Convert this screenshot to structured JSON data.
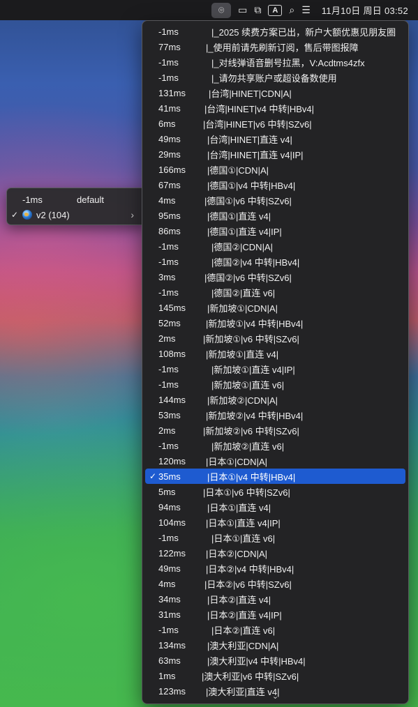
{
  "menubar": {
    "icons": [
      {
        "name": "proxy-app-icon",
        "glyph": "⌾",
        "active": true
      },
      {
        "name": "camera-icon",
        "glyph": "▭",
        "active": false
      },
      {
        "name": "screen-mirroring-icon",
        "glyph": "⧉",
        "active": false
      },
      {
        "name": "input-method-icon",
        "glyph": "A",
        "active": false
      },
      {
        "name": "spotlight-search-icon",
        "glyph": "⌕",
        "active": false
      },
      {
        "name": "control-center-icon",
        "glyph": "☰",
        "active": false
      }
    ],
    "clock": "11月10日 周日 03:52"
  },
  "profile_menu": {
    "latency": "-1ms",
    "group_name": "default",
    "selected_check": "✓",
    "subscription": "v2 (104)",
    "chevron": "›"
  },
  "server_menu": {
    "selected_check": "✓",
    "scroll_indicator": "⌄",
    "items": [
      {
        "latency": "-1ms",
        "name": "|_2025 续费方案已出，新户大额优惠见朋友圈",
        "indent": 76
      },
      {
        "latency": "77ms",
        "name": "|_使用前请先刷新订阅，售后带图报障",
        "indent": 68
      },
      {
        "latency": "-1ms",
        "name": "|_对线弹语音删号拉黑，V:Acdtms4zfx",
        "indent": 76
      },
      {
        "latency": "-1ms",
        "name": "|_请勿共享账户或超设备数使用",
        "indent": 76
      },
      {
        "latency": "131ms",
        "name": "|台湾|HINET|CDN|A|",
        "indent": 72
      },
      {
        "latency": "41ms",
        "name": "|台湾|HINET|v4 中转|HBv4|",
        "indent": 66
      },
      {
        "latency": "6ms",
        "name": "|台湾|HINET|v6 中转|SZv6|",
        "indent": 64
      },
      {
        "latency": "49ms",
        "name": "|台湾|HINET|直连 v4|",
        "indent": 70
      },
      {
        "latency": "29ms",
        "name": "|台湾|HINET|直连 v4|IP|",
        "indent": 70
      },
      {
        "latency": "166ms",
        "name": "|德国①|CDN|A|",
        "indent": 70
      },
      {
        "latency": "67ms",
        "name": "|德国①|v4 中转|HBv4|",
        "indent": 70
      },
      {
        "latency": "4ms",
        "name": "|德国①|v6 中转|SZv6|",
        "indent": 66
      },
      {
        "latency": "95ms",
        "name": "|德国①|直连 v4|",
        "indent": 70
      },
      {
        "latency": "86ms",
        "name": "|德国①|直连 v4|IP|",
        "indent": 70
      },
      {
        "latency": "-1ms",
        "name": "|德国②|CDN|A|",
        "indent": 76
      },
      {
        "latency": "-1ms",
        "name": "|德国②|v4 中转|HBv4|",
        "indent": 76
      },
      {
        "latency": "3ms",
        "name": "|德国②|v6 中转|SZv6|",
        "indent": 66
      },
      {
        "latency": "-1ms",
        "name": "|德国②|直连 v6|",
        "indent": 76
      },
      {
        "latency": "145ms",
        "name": "|新加坡①|CDN|A|",
        "indent": 70
      },
      {
        "latency": "52ms",
        "name": "|新加坡①|v4 中转|HBv4|",
        "indent": 68
      },
      {
        "latency": "2ms",
        "name": "|新加坡①|v6 中转|SZv6|",
        "indent": 64
      },
      {
        "latency": "108ms",
        "name": "|新加坡①|直连 v4|",
        "indent": 68
      },
      {
        "latency": "-1ms",
        "name": "|新加坡①|直连 v4|IP|",
        "indent": 76
      },
      {
        "latency": "-1ms",
        "name": "|新加坡①|直连 v6|",
        "indent": 76
      },
      {
        "latency": "144ms",
        "name": "|新加坡②|CDN|A|",
        "indent": 70
      },
      {
        "latency": "53ms",
        "name": "|新加坡②|v4 中转|HBv4|",
        "indent": 68
      },
      {
        "latency": "2ms",
        "name": "|新加坡②|v6 中转|SZv6|",
        "indent": 64
      },
      {
        "latency": "-1ms",
        "name": "|新加坡②|直连 v6|",
        "indent": 76
      },
      {
        "latency": "120ms",
        "name": "|日本①|CDN|A|",
        "indent": 68
      },
      {
        "latency": "35ms",
        "name": "|日本①|v4 中转|HBv4|",
        "indent": 70,
        "selected": true
      },
      {
        "latency": "5ms",
        "name": "|日本①|v6 中转|SZv6|",
        "indent": 64
      },
      {
        "latency": "94ms",
        "name": "|日本①|直连 v4|",
        "indent": 70
      },
      {
        "latency": "104ms",
        "name": "|日本①|直连 v4|IP|",
        "indent": 68
      },
      {
        "latency": "-1ms",
        "name": "|日本①|直连 v6|",
        "indent": 76
      },
      {
        "latency": "122ms",
        "name": "|日本②|CDN|A|",
        "indent": 68
      },
      {
        "latency": "49ms",
        "name": "|日本②|v4 中转|HBv4|",
        "indent": 68
      },
      {
        "latency": "4ms",
        "name": "|日本②|v6 中转|SZv6|",
        "indent": 66
      },
      {
        "latency": "34ms",
        "name": "|日本②|直连 v4|",
        "indent": 70
      },
      {
        "latency": "31ms",
        "name": "|日本②|直连 v4|IP|",
        "indent": 70
      },
      {
        "latency": "-1ms",
        "name": "|日本②|直连 v6|",
        "indent": 76
      },
      {
        "latency": "134ms",
        "name": "|澳大利亚|CDN|A|",
        "indent": 70
      },
      {
        "latency": "63ms",
        "name": "|澳大利亚|v4 中转|HBv4|",
        "indent": 70
      },
      {
        "latency": "1ms",
        "name": "|澳大利亚|v6 中转|SZv6|",
        "indent": 62
      },
      {
        "latency": "123ms",
        "name": "|澳大利亚|直连 v4|",
        "indent": 68
      }
    ]
  }
}
